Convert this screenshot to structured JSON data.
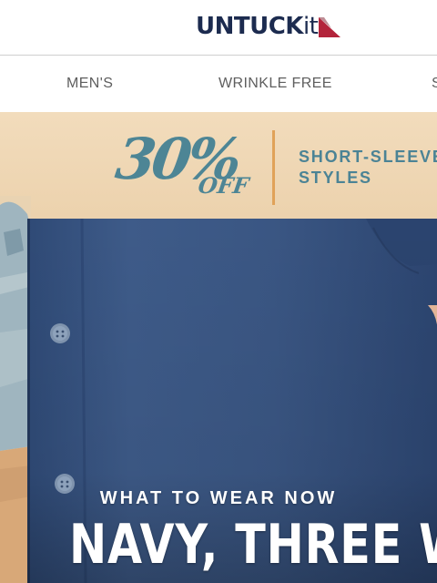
{
  "header": {
    "logo_main": "UNTUCK",
    "logo_suffix": "it"
  },
  "nav": {
    "items": [
      {
        "label": "MEN'S"
      },
      {
        "label": "WRINKLE FREE"
      },
      {
        "label": "S"
      }
    ]
  },
  "promo": {
    "percent": "30%",
    "off": "OFF",
    "line1": "SHORT-SLEEVE",
    "line2": "STYLES"
  },
  "hero": {
    "subtitle": "WHAT TO WEAR NOW",
    "title": "NAVY, THREE WAYS"
  },
  "colors": {
    "navy_brand": "#1c2b4f",
    "logo_flag_red": "#b3243b",
    "promo_teal": "#4d8595",
    "promo_divider": "#e0a259",
    "shirt_navy": "#3a5683"
  },
  "icons": {
    "logo_mark": "red-flag-triangle"
  }
}
